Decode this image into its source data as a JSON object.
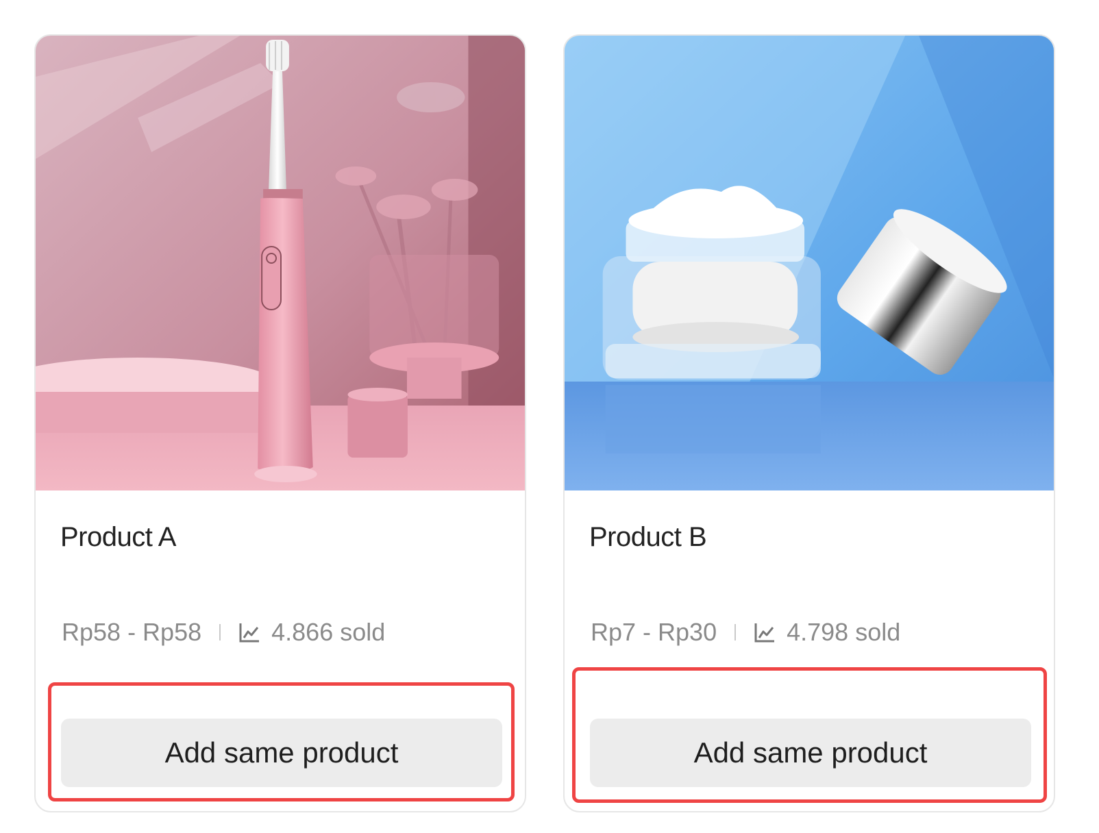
{
  "products": [
    {
      "name": "Product A",
      "price_range": "Rp58 - Rp58",
      "sold": "4.866 sold",
      "image": "pink-electric-toothbrush",
      "button_label": "Add same product",
      "icon": "trend-chart-icon",
      "accent": "#e7a3b3"
    },
    {
      "name": "Product B",
      "price_range": "Rp7 - Rp30",
      "sold": "4.798 sold",
      "image": "cream-jar-with-silver-lid",
      "button_label": "Add same product",
      "icon": "trend-chart-icon",
      "accent": "#5fa8ea"
    }
  ],
  "highlight_color": "#ef4444"
}
